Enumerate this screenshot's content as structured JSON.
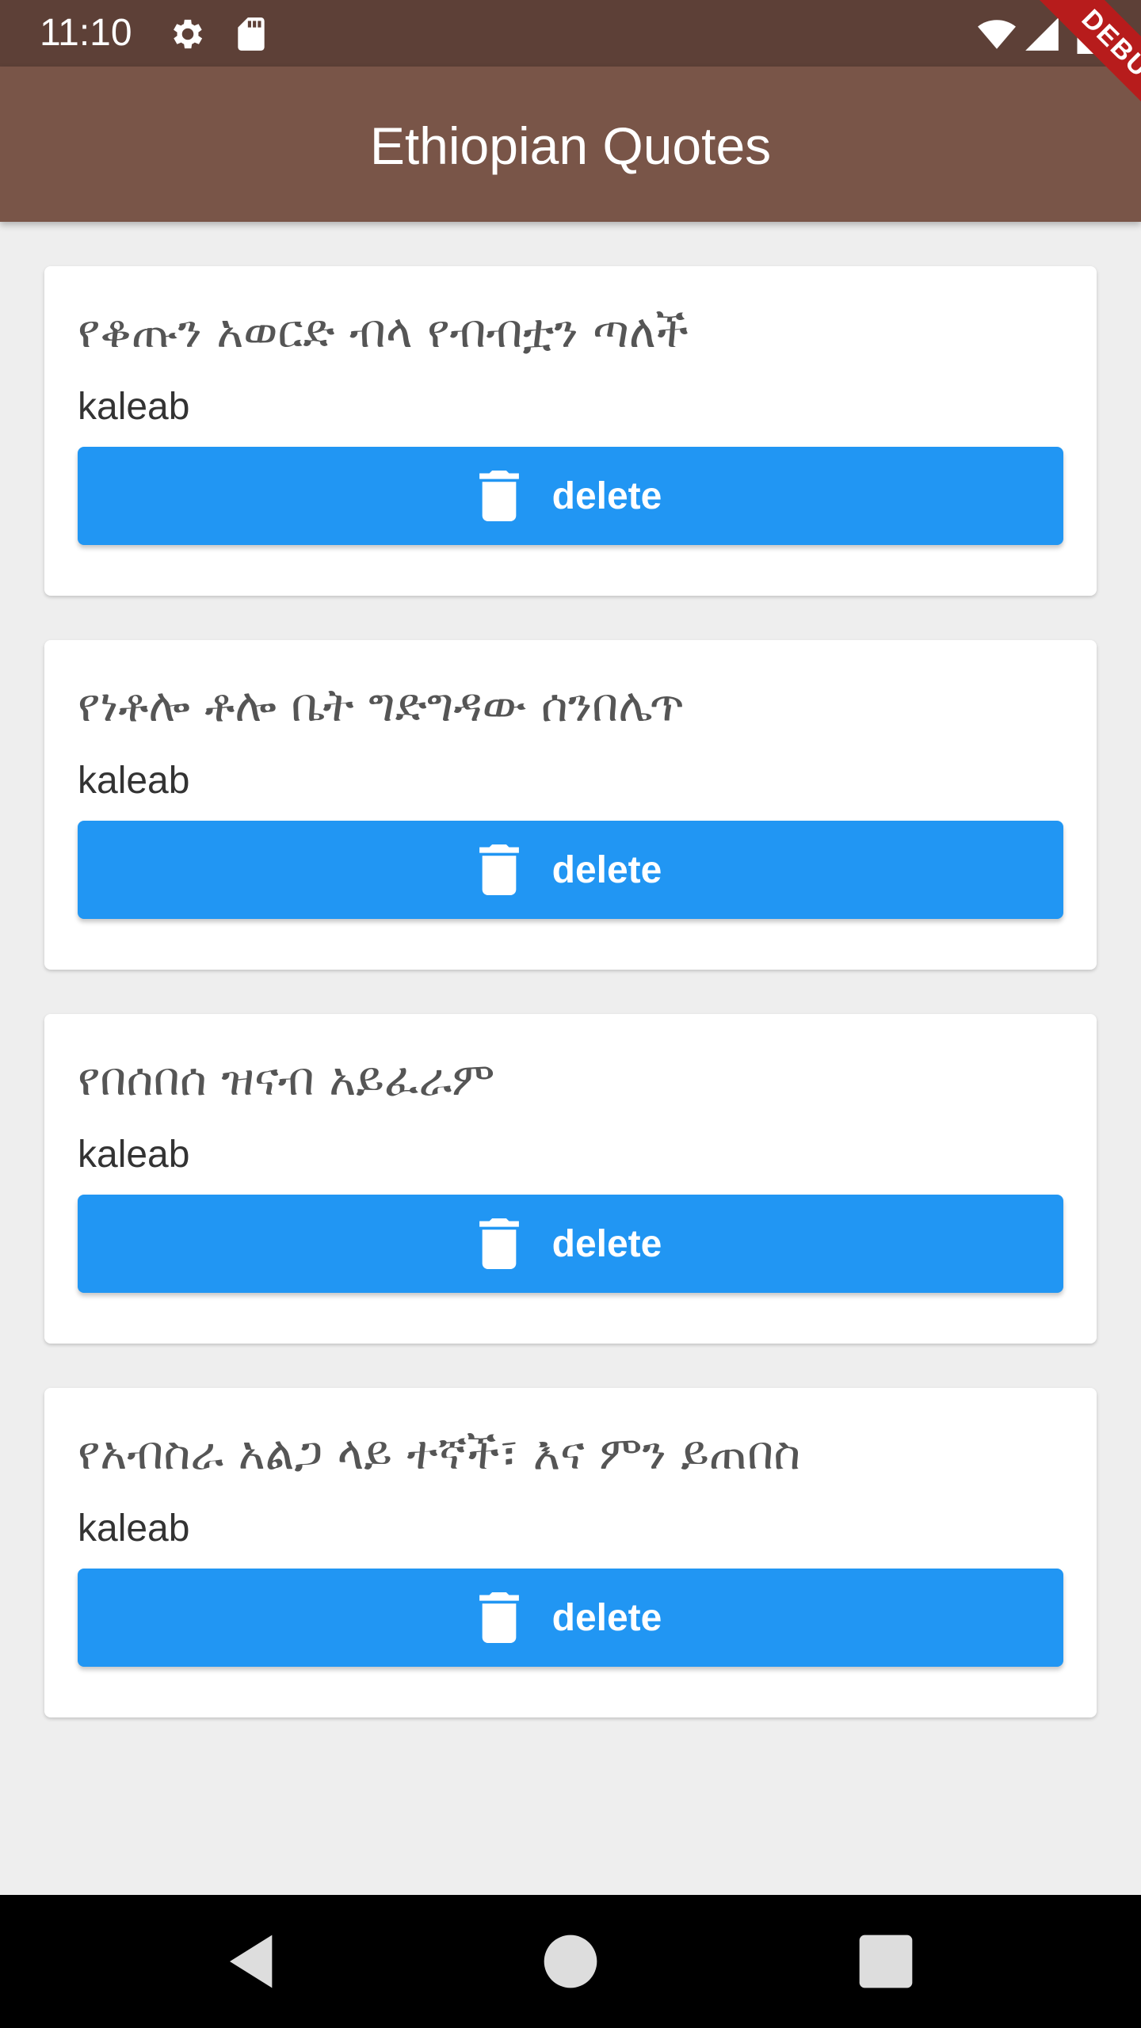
{
  "status_bar": {
    "time": "11:10",
    "icons": [
      "gear-icon",
      "sd-card-icon",
      "wifi-icon",
      "signal-icon",
      "battery-icon"
    ]
  },
  "app_bar": {
    "title": "Ethiopian Quotes",
    "color": "#795548"
  },
  "debug_banner": {
    "label": "DEBUG"
  },
  "quotes": [
    {
      "text": "የቆጡን አወርድ ብላ የብብቷን ጣለች",
      "author": "kaleab",
      "button_label": "delete"
    },
    {
      "text": "የነቶሎ ቶሎ ቤት ግድግዳው ሰንበሌጥ",
      "author": "kaleab",
      "button_label": "delete"
    },
    {
      "text": "የበሰበሰ ዝናብ አይፈራም",
      "author": "kaleab",
      "button_label": "delete"
    },
    {
      "text": "የአብስራ አልጋ ላይ ተኛች፣ እና ምን ይጠበስ",
      "author": "kaleab",
      "button_label": "delete"
    }
  ],
  "colors": {
    "status_bar": "#5d4037",
    "button": "#2196f3",
    "background": "#eeeeee"
  },
  "nav_bar": {
    "icons": [
      "back-icon",
      "home-icon",
      "recents-icon"
    ]
  }
}
